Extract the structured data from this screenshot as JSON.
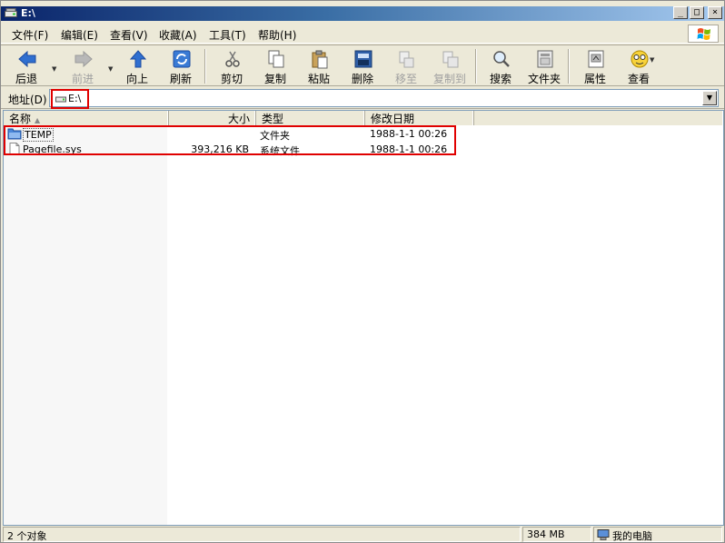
{
  "window": {
    "title": "E:\\"
  },
  "menu": [
    "文件(F)",
    "编辑(E)",
    "查看(V)",
    "收藏(A)",
    "工具(T)",
    "帮助(H)"
  ],
  "toolbar": {
    "back": "后退",
    "forward": "前进",
    "up": "向上",
    "refresh": "刷新",
    "cut": "剪切",
    "copy": "复制",
    "paste": "粘贴",
    "delete": "删除",
    "move_to": "移至",
    "copy_to": "复制到",
    "search": "搜索",
    "folders": "文件夹",
    "properties": "属性",
    "views": "查看"
  },
  "address": {
    "label": "地址(D)",
    "value": "E:\\"
  },
  "columns": {
    "name": "名称",
    "size": "大小",
    "type": "类型",
    "modified": "修改日期"
  },
  "files": [
    {
      "name": "TEMP",
      "size": "",
      "type": "文件夹",
      "modified": "1988-1-1 00:26",
      "icon": "folder-icon"
    },
    {
      "name": "Pagefile.sys",
      "size": "393,216 KB",
      "type": "系统文件",
      "modified": "1988-1-1 00:26",
      "icon": "file-icon"
    }
  ],
  "status": {
    "count": "2 个对象",
    "size": "384 MB",
    "location": "我的电脑"
  },
  "colors": {
    "highlight": "#e00000",
    "title_start": "#0a246a",
    "title_end": "#a6caf0",
    "face": "#ece9d8"
  }
}
